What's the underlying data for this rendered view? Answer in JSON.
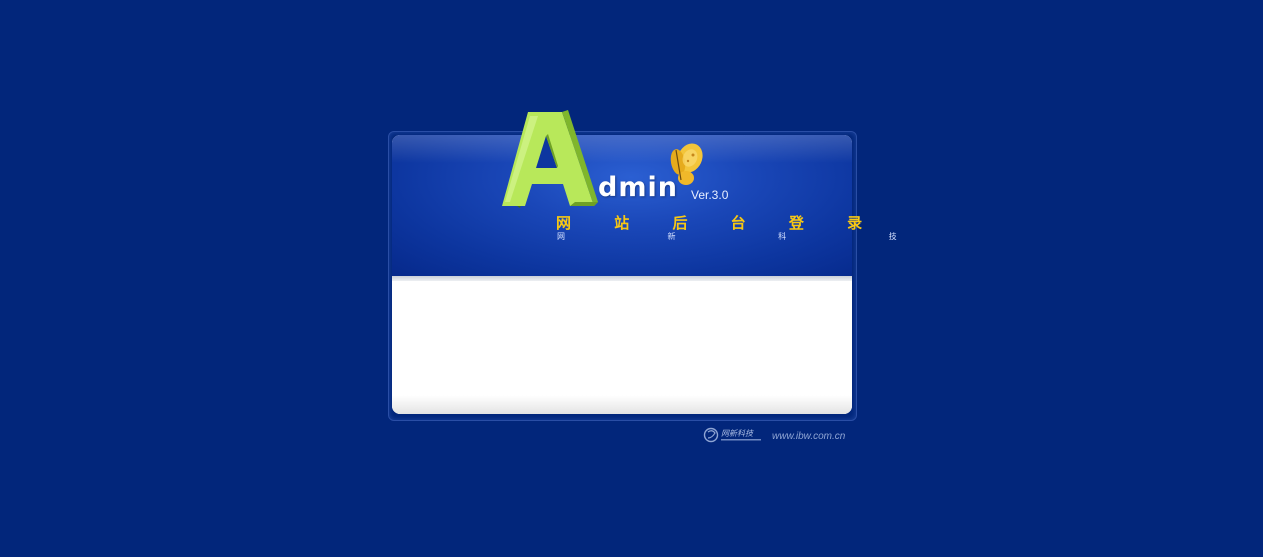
{
  "header": {
    "logo_rest": "dmin",
    "version": "Ver.3.0",
    "title": "网 站 后 台 登 录",
    "subtitle": "网 新 科 技"
  },
  "footer": {
    "company_name": "网新科技",
    "url": "www.ibw.com.cn"
  },
  "colors": {
    "background": "#02267b",
    "banner_blue": "#1a47b8",
    "logo_green": "#b8e85a",
    "title_yellow": "#f8c813",
    "panel_white": "#ffffff"
  },
  "icons": {
    "logo_letter": "logo-a-icon",
    "butterfly": "butterfly-icon",
    "company_logo": "company-logo-icon"
  }
}
